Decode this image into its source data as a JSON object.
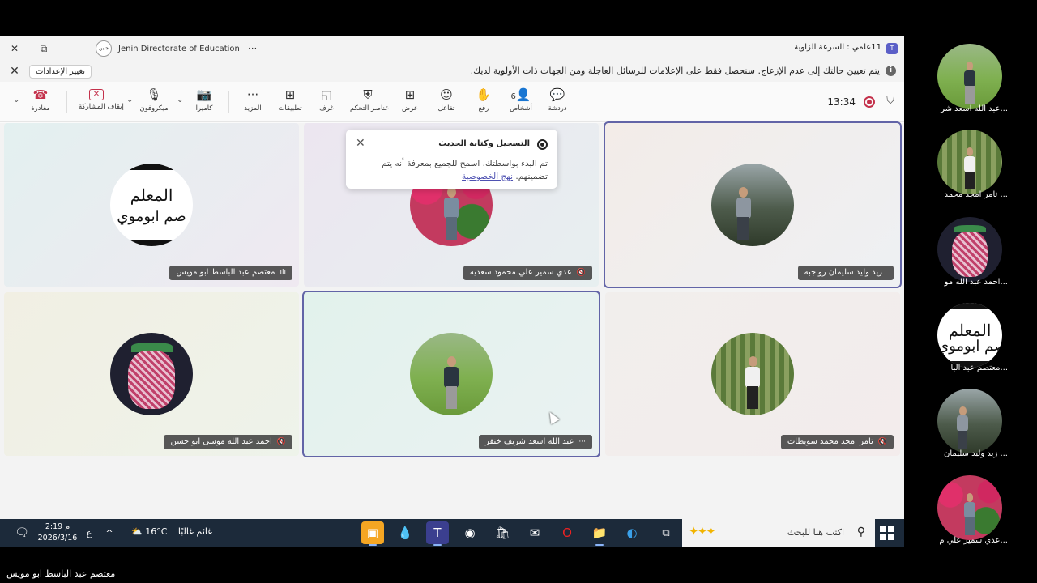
{
  "window": {
    "org_name": "Jenin Directorate of Education",
    "org_logo_text": "جنين",
    "meeting_title": "11علمي : السرعة الزاوية",
    "more_glyph": "···",
    "close_glyph": "✕",
    "restore_glyph": "⧉",
    "minimize_glyph": "—"
  },
  "notice": {
    "text": "يتم تعيين حالتك إلى عدم الإزعاج. ستحصل فقط على الإعلامات للرسائل العاجلة ومن الجهات ذات الأولوية لديك.",
    "settings_button": "تغيير الإعدادات",
    "close_glyph": "✕",
    "info_glyph": "i"
  },
  "toolbar": {
    "leave": "مغادرة",
    "stop_sharing": "إيقاف المشاركة",
    "microphone": "ميكروفون",
    "camera": "كاميرا",
    "more": "المزيد",
    "apps": "تطبيقات",
    "rooms": "غرف",
    "controls": "عناصر التحكم",
    "view": "عرض",
    "react": "تفاعل",
    "raise": "رفع",
    "people": "أشخاص",
    "people_count": "6",
    "chat": "دردشة",
    "timer": "13:34",
    "caret_glyph": "⌄"
  },
  "recording_popup": {
    "title": "التسجيل وكتابة الحديث",
    "body": "تم البدء بواسطتك. اسمح للجميع بمعرفة أنه يتم تضمينهم.",
    "link": "نهج الخصوصية",
    "close_glyph": "✕"
  },
  "participants": [
    {
      "name": "معتصم عبد الباسط ابو مويس",
      "status": "speaking",
      "status_glyph": "ılı",
      "avatar": "sign",
      "active": false
    },
    {
      "name": "عدي سمير علي محمود سعديه",
      "status": "muted",
      "status_glyph": "🔇",
      "avatar": "flowers",
      "active": false
    },
    {
      "name": "زيد وليد سليمان رواجبه",
      "status": "none",
      "status_glyph": "",
      "avatar": "tree",
      "active": true
    },
    {
      "name": "احمد عبد الله موسى ابو حسن",
      "status": "muted",
      "status_glyph": "🔇",
      "avatar": "keffiyeh",
      "active": false
    },
    {
      "name": "عبد الله اسعد شريف خنفر",
      "status": "more",
      "status_glyph": "···",
      "avatar": "grass",
      "active": true
    },
    {
      "name": "تامر امجد محمد سويطات",
      "status": "muted",
      "status_glyph": "🔇",
      "avatar": "wall",
      "active": false
    }
  ],
  "avatar_sign": {
    "line1": "المعلم",
    "line2": "صم ابوموي"
  },
  "strip": [
    {
      "name": "...عبد الله اسعد شر",
      "avatar": "grass"
    },
    {
      "name": "... تامر امجد محمد",
      "avatar": "wall"
    },
    {
      "name": "...احمد عبد الله مو",
      "avatar": "keffiyeh"
    },
    {
      "name": "...معتصم عبد البا",
      "avatar": "sign"
    },
    {
      "name": "... زيد وليد سليمان",
      "avatar": "tree"
    },
    {
      "name": "...عدي سمير علي م",
      "avatar": "flowers"
    }
  ],
  "taskbar": {
    "search_text": "اكتب هنا للبحث",
    "weather_temp": "16°C",
    "weather_cond": "غائم غالبًا",
    "time": "2:19 م",
    "date": "2026/3/16",
    "lang": "ع",
    "caret": "^"
  },
  "footer_name": "معتصم عبد الباسط ابو مويس",
  "colors": {
    "accent": "#6264a7",
    "leave": "#c4314b",
    "taskbar": "#1c2a3a"
  }
}
